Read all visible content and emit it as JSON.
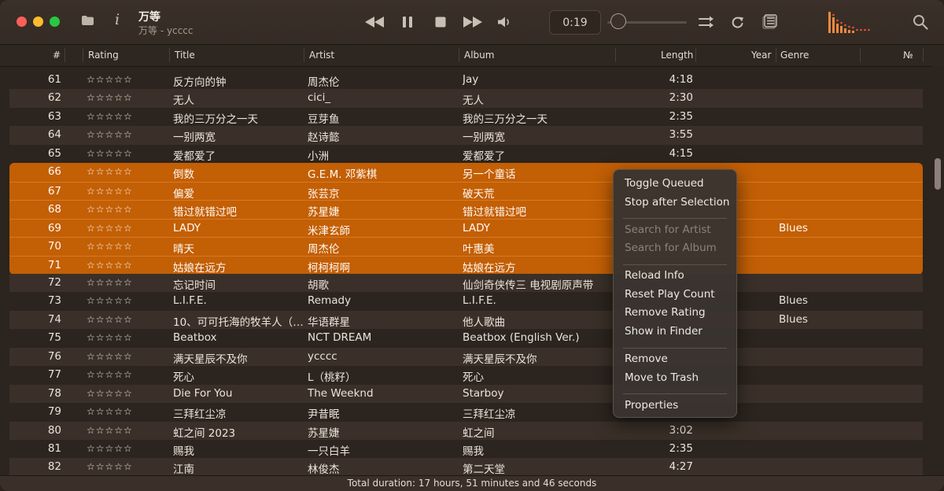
{
  "now_playing": {
    "title": "万等",
    "subtitle": "万等 - ycccc"
  },
  "player": {
    "time": "0:19",
    "seek_fraction": 0.1
  },
  "icons": [
    "folder-icon",
    "info-icon",
    "rewind-icon",
    "pause-icon",
    "stop-icon",
    "fast-forward-icon",
    "volume-icon",
    "shuffle-icon",
    "repeat-icon",
    "queue-icon",
    "visualizer-icon",
    "search-icon"
  ],
  "info_glyph": "i",
  "columns": {
    "num": "#",
    "rating": "Rating",
    "title": "Title",
    "artist": "Artist",
    "album": "Album",
    "length": "Length",
    "year": "Year",
    "genre": "Genre",
    "track_no": "№"
  },
  "rating_stars": "☆☆☆☆☆",
  "tracks": [
    {
      "num": "61",
      "title": "反方向的钟",
      "artist": "周杰伦",
      "album": "Jay",
      "length": "4:18",
      "genre": ""
    },
    {
      "num": "62",
      "title": "无人",
      "artist": "cici_",
      "album": "无人",
      "length": "2:30",
      "genre": ""
    },
    {
      "num": "63",
      "title": "我的三万分之一天",
      "artist": "豆芽鱼",
      "album": "我的三万分之一天",
      "length": "2:35",
      "genre": ""
    },
    {
      "num": "64",
      "title": "一别两宽",
      "artist": "赵诗懿",
      "album": "一别两宽",
      "length": "3:55",
      "genre": ""
    },
    {
      "num": "65",
      "title": "爱都爱了",
      "artist": "小洲",
      "album": "爱都爱了",
      "length": "4:15",
      "genre": ""
    },
    {
      "num": "66",
      "title": "倒数",
      "artist": "G.E.M. 邓紫棋",
      "album": "另一个童话",
      "length": "",
      "genre": ""
    },
    {
      "num": "67",
      "title": "偏爱",
      "artist": "张芸京",
      "album": "破天荒",
      "length": "",
      "genre": ""
    },
    {
      "num": "68",
      "title": "错过就错过吧",
      "artist": "苏星婕",
      "album": "错过就错过吧",
      "length": "",
      "genre": ""
    },
    {
      "num": "69",
      "title": "LADY",
      "artist": "米津玄師",
      "album": "LADY",
      "length": "",
      "genre": "Blues"
    },
    {
      "num": "70",
      "title": "晴天",
      "artist": "周杰伦",
      "album": "叶惠美",
      "length": "",
      "genre": ""
    },
    {
      "num": "71",
      "title": "姑娘在远方",
      "artist": "柯柯柯啊",
      "album": "姑娘在远方",
      "length": "",
      "genre": ""
    },
    {
      "num": "72",
      "title": "忘记时间",
      "artist": "胡歌",
      "album": "仙剑奇侠传三 电视剧原声带",
      "length": "",
      "genre": ""
    },
    {
      "num": "73",
      "title": "L.I.F.E.",
      "artist": "Remady",
      "album": "L.I.F.E.",
      "length": "",
      "genre": "Blues"
    },
    {
      "num": "74",
      "title": "10、可可托海的牧羊人（原唱…",
      "artist": "华语群星",
      "album": "他人歌曲",
      "length": "",
      "genre": "Blues"
    },
    {
      "num": "75",
      "title": "Beatbox",
      "artist": "NCT DREAM",
      "album": "Beatbox (English Ver.)",
      "length": "",
      "genre": ""
    },
    {
      "num": "76",
      "title": "满天星辰不及你",
      "artist": "ycccc",
      "album": "满天星辰不及你",
      "length": "",
      "genre": ""
    },
    {
      "num": "77",
      "title": "死心",
      "artist": "L（桃籽）",
      "album": "死心",
      "length": "",
      "genre": ""
    },
    {
      "num": "78",
      "title": "Die For You",
      "artist": "The Weeknd",
      "album": "Starboy",
      "length": "",
      "genre": ""
    },
    {
      "num": "79",
      "title": "三拜红尘凉",
      "artist": "尹昔眠",
      "album": "三拜红尘凉",
      "length": "",
      "genre": ""
    },
    {
      "num": "80",
      "title": "虹之间 2023",
      "artist": "苏星婕",
      "album": "虹之间",
      "length": "3:02",
      "genre": ""
    },
    {
      "num": "81",
      "title": "赐我",
      "artist": "一只白羊",
      "album": "赐我",
      "length": "2:35",
      "genre": ""
    },
    {
      "num": "82",
      "title": "江南",
      "artist": "林俊杰",
      "album": "第二天堂",
      "length": "4:27",
      "genre": ""
    }
  ],
  "selected_range": [
    "66",
    "71"
  ],
  "status": "Total duration: 17 hours, 51 minutes and 46 seconds",
  "context_menu": {
    "groups": [
      [
        {
          "label": "Toggle Queued",
          "enabled": true
        },
        {
          "label": "Stop after Selection",
          "enabled": true
        }
      ],
      [
        {
          "label": "Search for Artist",
          "enabled": false
        },
        {
          "label": "Search for Album",
          "enabled": false
        }
      ],
      [
        {
          "label": "Reload Info",
          "enabled": true
        },
        {
          "label": "Reset Play Count",
          "enabled": true
        },
        {
          "label": "Remove Rating",
          "enabled": true
        },
        {
          "label": "Show in Finder",
          "enabled": true
        }
      ],
      [
        {
          "label": "Remove",
          "enabled": true
        },
        {
          "label": "Move to Trash",
          "enabled": true
        }
      ],
      [
        {
          "label": "Properties",
          "enabled": true
        }
      ]
    ]
  },
  "colors": {
    "selection": "#c35f05",
    "visualizer_bar": "#f08a3c",
    "visualizer_dot": "#e8503c"
  }
}
